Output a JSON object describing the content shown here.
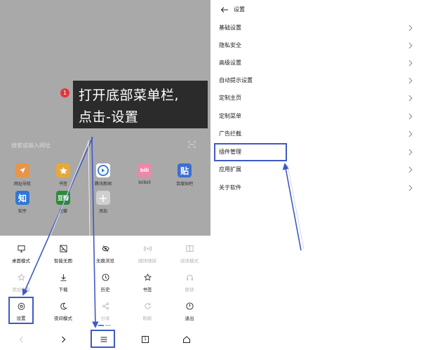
{
  "left": {
    "search_placeholder": "搜索或输入网址",
    "sites": [
      {
        "label": "网址导航",
        "icon": "navigation-icon",
        "color": "#e8944a",
        "glyph": ""
      },
      {
        "label": "书签",
        "icon": "star-icon",
        "color": "#e7a83a",
        "glyph": ""
      },
      {
        "label": "腾讯新闻",
        "icon": "tencent-news-icon",
        "color": "#ffffff",
        "glyph": ""
      },
      {
        "label": "bilibili",
        "icon": "bilibili-icon",
        "color": "#e88aa8",
        "glyph": "bili"
      },
      {
        "label": "百度贴吧",
        "icon": "tieba-icon",
        "color": "#3e6fd1",
        "glyph": "贴"
      },
      {
        "label": "知乎",
        "icon": "zhihu-icon",
        "color": "#2f77d6",
        "glyph": "知"
      },
      {
        "label": "豆瓣",
        "icon": "douban-icon",
        "color": "#2e8a3a",
        "glyph": "豆瓣"
      },
      {
        "label": "添加",
        "icon": "add-icon",
        "color": "#cfcfcf",
        "glyph": "+"
      }
    ],
    "callout": {
      "badge": "1",
      "line1": "打开底部菜单栏,",
      "line2": "点击-设置"
    },
    "menu": [
      {
        "label": "桌面模式",
        "icon": "desktop-icon",
        "enabled": true
      },
      {
        "label": "智能无图",
        "icon": "no-image-icon",
        "enabled": true
      },
      {
        "label": "无痕浏览",
        "icon": "incognito-icon",
        "enabled": true
      },
      {
        "label": "媒体嗅探",
        "icon": "media-sniff-icon",
        "enabled": false
      },
      {
        "label": "阅读模式",
        "icon": "reading-icon",
        "enabled": false
      },
      {
        "label": "添加收藏",
        "icon": "star-outline-icon",
        "enabled": false
      },
      {
        "label": "下载",
        "icon": "download-icon",
        "enabled": true
      },
      {
        "label": "历史",
        "icon": "history-icon",
        "enabled": true
      },
      {
        "label": "书签",
        "icon": "bookmark-star-icon",
        "enabled": true
      },
      {
        "label": "朗读",
        "icon": "headphones-icon",
        "enabled": false
      },
      {
        "label": "设置",
        "icon": "settings-gear-icon",
        "enabled": true
      },
      {
        "label": "夜间模式",
        "icon": "moon-icon",
        "enabled": true
      },
      {
        "label": "分享",
        "icon": "share-icon",
        "enabled": false
      },
      {
        "label": "刷新",
        "icon": "refresh-icon",
        "enabled": false
      },
      {
        "label": "退出",
        "icon": "power-icon",
        "enabled": true
      }
    ],
    "nav": [
      {
        "icon": "back-arrow-icon",
        "enabled": false
      },
      {
        "icon": "forward-arrow-icon",
        "enabled": true
      },
      {
        "icon": "menu-icon",
        "enabled": true
      },
      {
        "icon": "tabs-icon",
        "enabled": true,
        "count": "1"
      },
      {
        "icon": "home-icon",
        "enabled": true
      }
    ]
  },
  "right": {
    "title": "设置",
    "items": [
      "基础设置",
      "隐私安全",
      "高级设置",
      "自动提示设置",
      "定制主页",
      "定制菜单",
      "广告拦截",
      "插件管理",
      "应用扩展",
      "关于软件"
    ]
  },
  "colors": {
    "highlight": "#3f59c4",
    "dim_overlay": "#a9a9a9",
    "badge": "#e3353b",
    "callout_bg": "#2b2b2b",
    "indicator": "#3a8ee6"
  }
}
